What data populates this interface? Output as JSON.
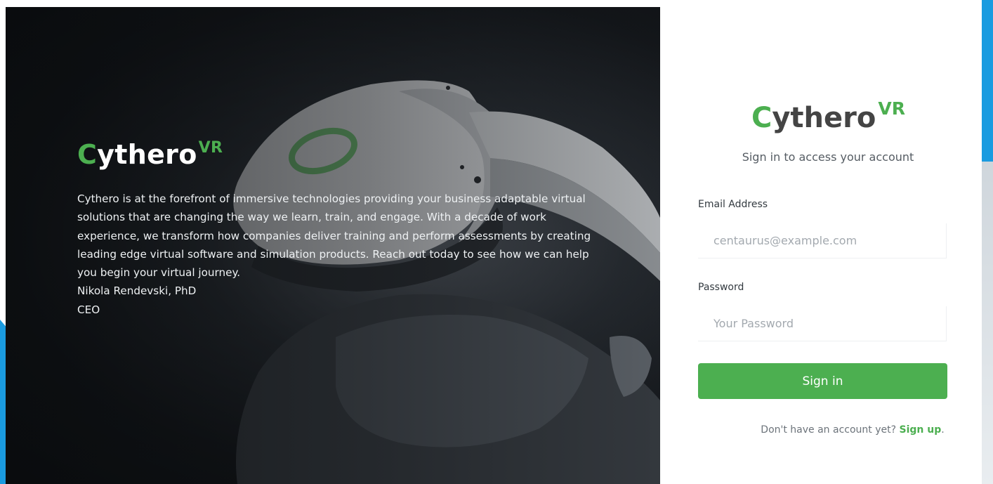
{
  "hero": {
    "brand_initial": "C",
    "brand_rest": "ythero",
    "brand_sup": "VR",
    "paragraph": "Cythero is at the forefront of immersive technologies providing your business adaptable virtual solutions that are changing the way we learn, train, and engage. With a decade of work experience, we transform how companies deliver training and perform assessments by creating leading edge virtual software and simulation products. Reach out today to see how we can help you begin your virtual journey.",
    "signature_name": "Nikola Rendevski, PhD",
    "signature_title": "CEO",
    "image_alt": "person wearing VR headset"
  },
  "login": {
    "brand_initial": "C",
    "brand_rest": "ythero",
    "brand_sup": "VR",
    "subtitle": "Sign in to access your account",
    "email_label": "Email Address",
    "email_placeholder": "centaurus@example.com",
    "password_label": "Password",
    "password_placeholder": "Your Password",
    "signin_label": "Sign in",
    "signup_prompt": "Don't have an account yet?",
    "signup_link": "Sign up",
    "signup_suffix": "."
  },
  "colors": {
    "accent": "#4caf50",
    "frame_blue": "#1a9be0",
    "hero_bg": "#15181c"
  }
}
